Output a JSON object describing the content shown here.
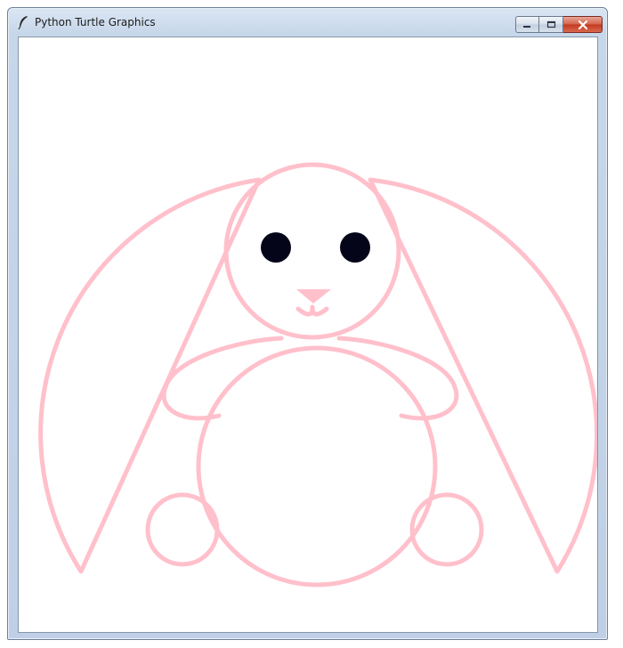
{
  "window": {
    "title": "Python Turtle Graphics",
    "controls": [
      "minimize",
      "maximize",
      "close"
    ]
  },
  "icons": {
    "app": "feather-icon",
    "minimize": "minimize-icon",
    "maximize": "maximize-icon",
    "close": "close-icon"
  },
  "colors": {
    "outline": "#ffc0cb",
    "eyes": "#05051a",
    "nose": "#ffc0cb",
    "canvas": "#ffffff"
  }
}
